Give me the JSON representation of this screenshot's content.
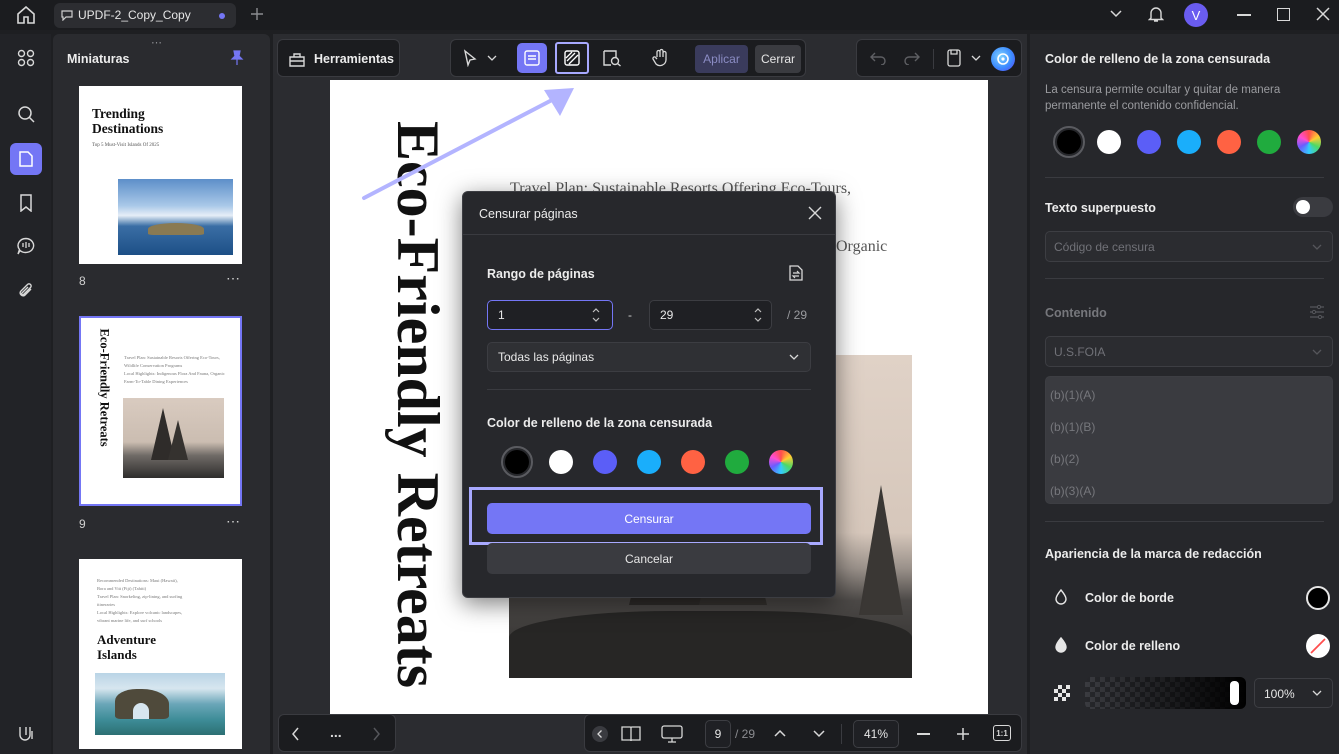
{
  "titlebar": {
    "tab_title": "UPDF-2_Copy_Copy",
    "user_initial": "V"
  },
  "thumbnails": {
    "title": "Miniaturas",
    "pages": [
      {
        "number": "8",
        "heading1": "Trending",
        "heading2": "Destinations",
        "sub": "Top 5 Must-Visit Islands Of 2025"
      },
      {
        "number": "9",
        "vertical_title": "Eco-Friendly Retreats",
        "lines": [
          "Travel Plan: Sustainable Resorts Offering Eco-Tours,",
          "Wildlife Conservation Programs",
          "Local Highlights: Indigenous Flora And Fauna, Organic",
          "Farm-To-Table Dining Experiences"
        ]
      },
      {
        "number": "",
        "heading1": "Adventure",
        "heading2": "Islands",
        "lines": [
          "Recommended Destinations: Maui (Hawaii),",
          "Bora and Viti (Fiji) (Tahiti)",
          "Travel Plan: Snorkeling, zip-lining, and surfing",
          "itineraries",
          "Local Highlights: Explore volcanic landscapes,",
          "vibrant marine life, and surf schools"
        ]
      }
    ]
  },
  "toolbar": {
    "tools_label": "Herramientas",
    "apply_label": "Aplicar",
    "close_label": "Cerrar"
  },
  "page": {
    "vertical_title": "Eco-Friendly Retreats",
    "line1": "Travel Plan: Sustainable Resorts Offering Eco-Tours,",
    "line2_suffix": "Organic"
  },
  "dialog": {
    "title": "Censurar páginas",
    "range_label": "Rango de páginas",
    "from_value": "1",
    "to_value": "29",
    "dash": "-",
    "total": "/ 29",
    "pages_select": "Todas las páginas",
    "fill_label": "Color de relleno de la zona censurada",
    "colors": [
      "#000000",
      "#ffffff",
      "#5b5ef7",
      "#1aaefb",
      "#ff6243",
      "#20ab3e"
    ],
    "censor_button": "Censurar",
    "cancel_button": "Cancelar"
  },
  "right_panel": {
    "fill_title": "Color de relleno de la zona censurada",
    "fill_desc_1": "La censura permite ocultar y quitar de manera",
    "fill_desc_2": "permanente el contenido confidencial.",
    "colors": [
      "#000000",
      "#ffffff",
      "#5b5ef7",
      "#1aaefb",
      "#ff6243",
      "#20ab3e"
    ],
    "overlay_label": "Texto superpuesto",
    "overlay_placeholder": "Código de censura",
    "content_label": "Contenido",
    "content_select": "U.S.FOIA",
    "content_items": [
      "(b)(1)(A)",
      "(b)(1)(B)",
      "(b)(2)",
      "(b)(3)(A)"
    ],
    "appearance_label": "Apariencia de la marca de redacción",
    "border_color_label": "Color de borde",
    "fill_color_label": "Color de relleno",
    "opacity_value": "100%"
  },
  "bottom_bar": {
    "current_page": "9",
    "total_pages": "/ 29",
    "zoom": "41%",
    "more": "..."
  },
  "colors": {
    "accent": "#7476f5",
    "highlight_border": "#a8a9ff"
  }
}
